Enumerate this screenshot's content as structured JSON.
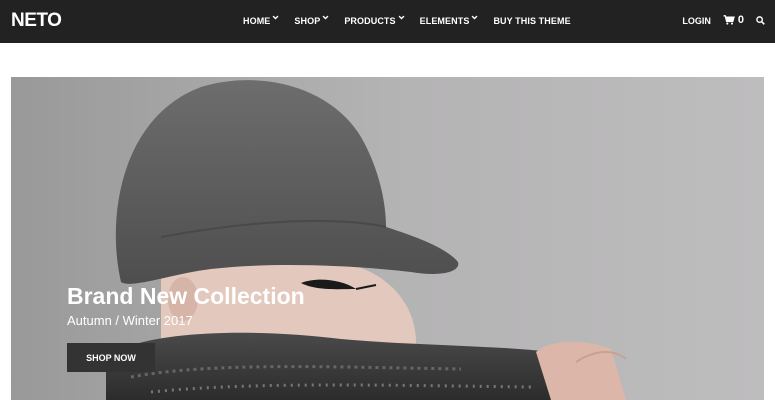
{
  "header": {
    "logo": "NETO",
    "nav": [
      {
        "label": "HOME",
        "dropdown": true
      },
      {
        "label": "SHOP",
        "dropdown": true
      },
      {
        "label": "PRODUCTS",
        "dropdown": true
      },
      {
        "label": "ELEMENTS",
        "dropdown": true
      },
      {
        "label": "BUY THIS THEME",
        "dropdown": false
      }
    ],
    "login_label": "LOGIN",
    "cart_count": "0",
    "icons": {
      "cart": "shopping-cart-icon",
      "search": "search-icon",
      "dropdown": "chevron-down-icon"
    }
  },
  "hero": {
    "title": "Brand New Collection",
    "subtitle": "Autumn / Winter 2017",
    "button_label": "SHOP NOW"
  },
  "colors": {
    "topbar": "#222222",
    "hero_bg": "#b3b2b3",
    "button_bg": "#333333",
    "text_light": "#ffffff"
  }
}
